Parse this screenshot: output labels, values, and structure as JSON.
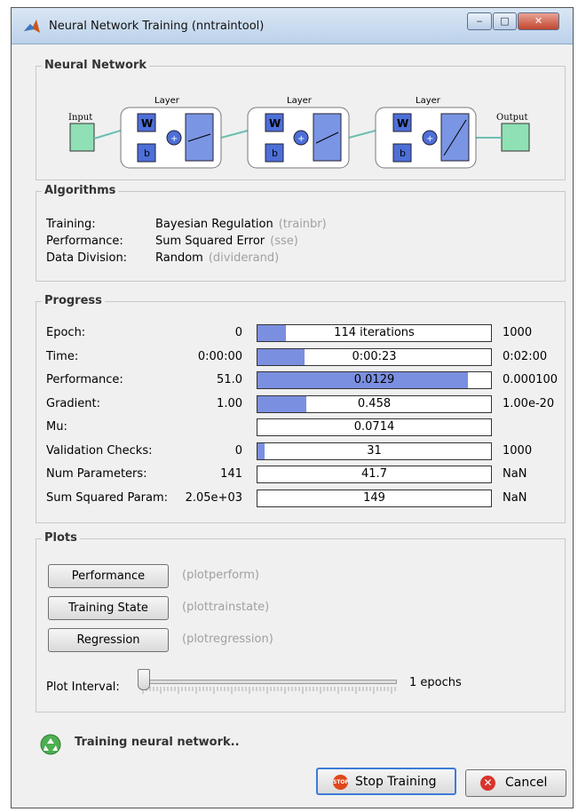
{
  "window": {
    "title": "Neural Network Training (nntraintool)"
  },
  "network": {
    "section_title": "Neural Network",
    "input_label": "Input",
    "output_label": "Output",
    "layers": [
      {
        "label": "Layer",
        "w": "W",
        "b": "b"
      },
      {
        "label": "Layer",
        "w": "W",
        "b": "b"
      },
      {
        "label": "Layer",
        "w": "W",
        "b": "b"
      }
    ]
  },
  "algorithms": {
    "section_title": "Algorithms",
    "rows": [
      {
        "label": "Training:",
        "value": "Bayesian Regulation",
        "func": "(trainbr)"
      },
      {
        "label": "Performance:",
        "value": "Sum Squared Error",
        "func": "(sse)"
      },
      {
        "label": "Data Division:",
        "value": "Random",
        "func": "(dividerand)"
      }
    ]
  },
  "progress": {
    "section_title": "Progress",
    "rows": [
      {
        "label": "Epoch:",
        "start": "0",
        "current": "114 iterations",
        "end": "1000",
        "fraction": 0.12
      },
      {
        "label": "Time:",
        "start": "0:00:00",
        "current": "0:00:23",
        "end": "0:02:00",
        "fraction": 0.2
      },
      {
        "label": "Performance:",
        "start": "51.0",
        "current": "0.0129",
        "end": "0.000100",
        "fraction": 0.9
      },
      {
        "label": "Gradient:",
        "start": "1.00",
        "current": "0.458",
        "end": "1.00e-20",
        "fraction": 0.21
      },
      {
        "label": "Mu:",
        "start": "",
        "current": "0.0714",
        "end": "",
        "fraction": 0
      },
      {
        "label": "Validation Checks:",
        "start": "0",
        "current": "31",
        "end": "1000",
        "fraction": 0.031
      },
      {
        "label": "Num Parameters:",
        "start": "141",
        "current": "41.7",
        "end": "NaN",
        "fraction": 0
      },
      {
        "label": "Sum Squared Param:",
        "start": "2.05e+03",
        "current": "149",
        "end": "NaN",
        "fraction": 0
      }
    ]
  },
  "plots": {
    "section_title": "Plots",
    "buttons": [
      {
        "label": "Performance",
        "func": "(plotperform)"
      },
      {
        "label": "Training State",
        "func": "(plottrainstate)"
      },
      {
        "label": "Regression",
        "func": "(plotregression)"
      }
    ],
    "interval_label": "Plot Interval:",
    "interval_value": "1 epochs"
  },
  "status": {
    "text": "Training neural network.."
  },
  "actions": {
    "stop_label": "Stop Training",
    "cancel_label": "Cancel"
  }
}
